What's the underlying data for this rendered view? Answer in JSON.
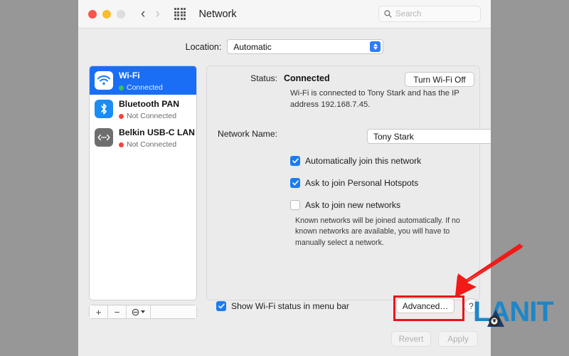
{
  "window": {
    "title": "Network",
    "traffic_lights": [
      "close",
      "minimize",
      "zoom"
    ],
    "nav_back_icon": "chevron-left-icon",
    "nav_forward_icon": "chevron-right-icon",
    "grid_icon": "grid-apps-icon",
    "search": {
      "placeholder": "Search",
      "value": "",
      "icon": "search-icon"
    }
  },
  "location": {
    "label": "Location:",
    "value": "Automatic"
  },
  "sidebar": {
    "services": [
      {
        "name": "Wi-Fi",
        "status": "Connected",
        "status_color": "#37c84a",
        "icon": "wifi-icon",
        "selected": true
      },
      {
        "name": "Bluetooth PAN",
        "status": "Not Connected",
        "status_color": "#f0453f",
        "icon": "bluetooth-icon",
        "selected": false
      },
      {
        "name": "Belkin USB-C LAN",
        "status": "Not Connected",
        "status_color": "#f0453f",
        "icon": "ethernet-adapter-icon",
        "selected": false
      }
    ],
    "footer": {
      "add_label": "+",
      "remove_label": "−",
      "actions_icon": "gear-actions-icon"
    }
  },
  "main": {
    "status_label": "Status:",
    "status_value": "Connected",
    "toggle_wifi_label": "Turn Wi-Fi Off",
    "status_description": "Wi-Fi is connected to Tony Stark and has the IP address 192.168.7.45.",
    "network_name_label": "Network Name:",
    "network_name_value": "Tony Stark",
    "checkboxes": [
      {
        "label": "Automatically join this network",
        "checked": true
      },
      {
        "label": "Ask to join Personal Hotspots",
        "checked": true
      },
      {
        "label": "Ask to join new networks",
        "checked": false
      }
    ],
    "help_text": "Known networks will be joined automatically. If no known networks are available, you will have to manually select a network."
  },
  "bottom": {
    "show_status_label": "Show Wi-Fi status in menu bar",
    "show_status_checked": true,
    "advanced_label": "Advanced…",
    "help_label": "?",
    "revert_label": "Revert",
    "apply_label": "Apply"
  },
  "annotations": {
    "highlight_color": "#e8141e",
    "arrow_color": "#f01a16",
    "target": "advanced-button"
  },
  "watermark": {
    "text": "LANIT",
    "color": "#1f86c8"
  }
}
